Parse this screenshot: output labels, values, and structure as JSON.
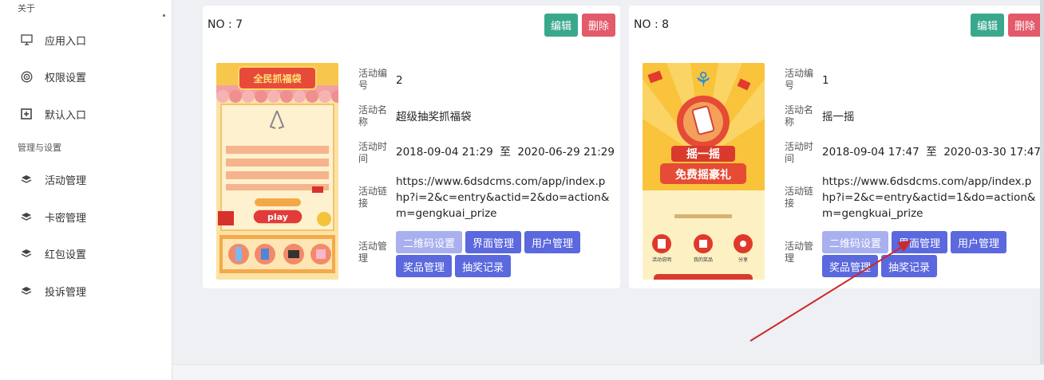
{
  "sidebar": {
    "about_title": "关于",
    "settings_title": "管理与设置",
    "items": [
      {
        "label": "应用入口",
        "icon": "monitor-icon"
      },
      {
        "label": "权限设置",
        "icon": "target-icon"
      },
      {
        "label": "默认入口",
        "icon": "plus-square-icon"
      },
      {
        "label": "活动管理",
        "icon": "layers-icon"
      },
      {
        "label": "卡密管理",
        "icon": "layers-icon"
      },
      {
        "label": "红包设置",
        "icon": "layers-icon"
      },
      {
        "label": "投诉管理",
        "icon": "layers-icon"
      }
    ]
  },
  "cards": [
    {
      "no": "NO : 7",
      "edit_label": "编辑",
      "delete_label": "删除",
      "thumb": {
        "banner": "全民抓福袋",
        "play": "play"
      },
      "fields": {
        "id_label": "活动编号",
        "id_value": "2",
        "name_label": "活动名称",
        "name_value": "超级抽奖抓福袋",
        "time_label": "活动时间",
        "time_value": "2018-09-04 21:29  至  2020-06-29 21:29",
        "link_label": "活动链接",
        "link_value": "https://www.6dsdcms.com/app/index.php?i=2&c=entry&actid=2&do=action&m=gengkuai_prize",
        "manage_label": "活动管理"
      },
      "buttons": [
        "二维码设置",
        "界面管理",
        "用户管理",
        "奖品管理",
        "抽奖记录"
      ]
    },
    {
      "no": "NO : 8",
      "edit_label": "编辑",
      "delete_label": "删除",
      "thumb": {
        "line1": "摇一摇",
        "line2": "免费摇豪礼",
        "icons": [
          "活动说明",
          "我的奖品",
          "分享"
        ]
      },
      "fields": {
        "id_label": "活动编号",
        "id_value": "1",
        "name_label": "活动名称",
        "name_value": "摇一摇",
        "time_label": "活动时间",
        "time_value": "2018-09-04 17:47  至  2020-03-30 17:47",
        "link_label": "活动链接",
        "link_value": "https://www.6dsdcms.com/app/index.php?i=2&c=entry&actid=1&do=action&m=gengkuai_prize",
        "manage_label": "活动管理"
      },
      "buttons": [
        "二维码设置",
        "界面管理",
        "用户管理",
        "奖品管理",
        "抽奖记录"
      ]
    }
  ],
  "colors": {
    "edit": "#3aa88c",
    "delete": "#e35a6a",
    "manage_button": "#5b68de",
    "manage_button_light": "#a9b0ef",
    "annotation_arrow": "#d0282a"
  }
}
